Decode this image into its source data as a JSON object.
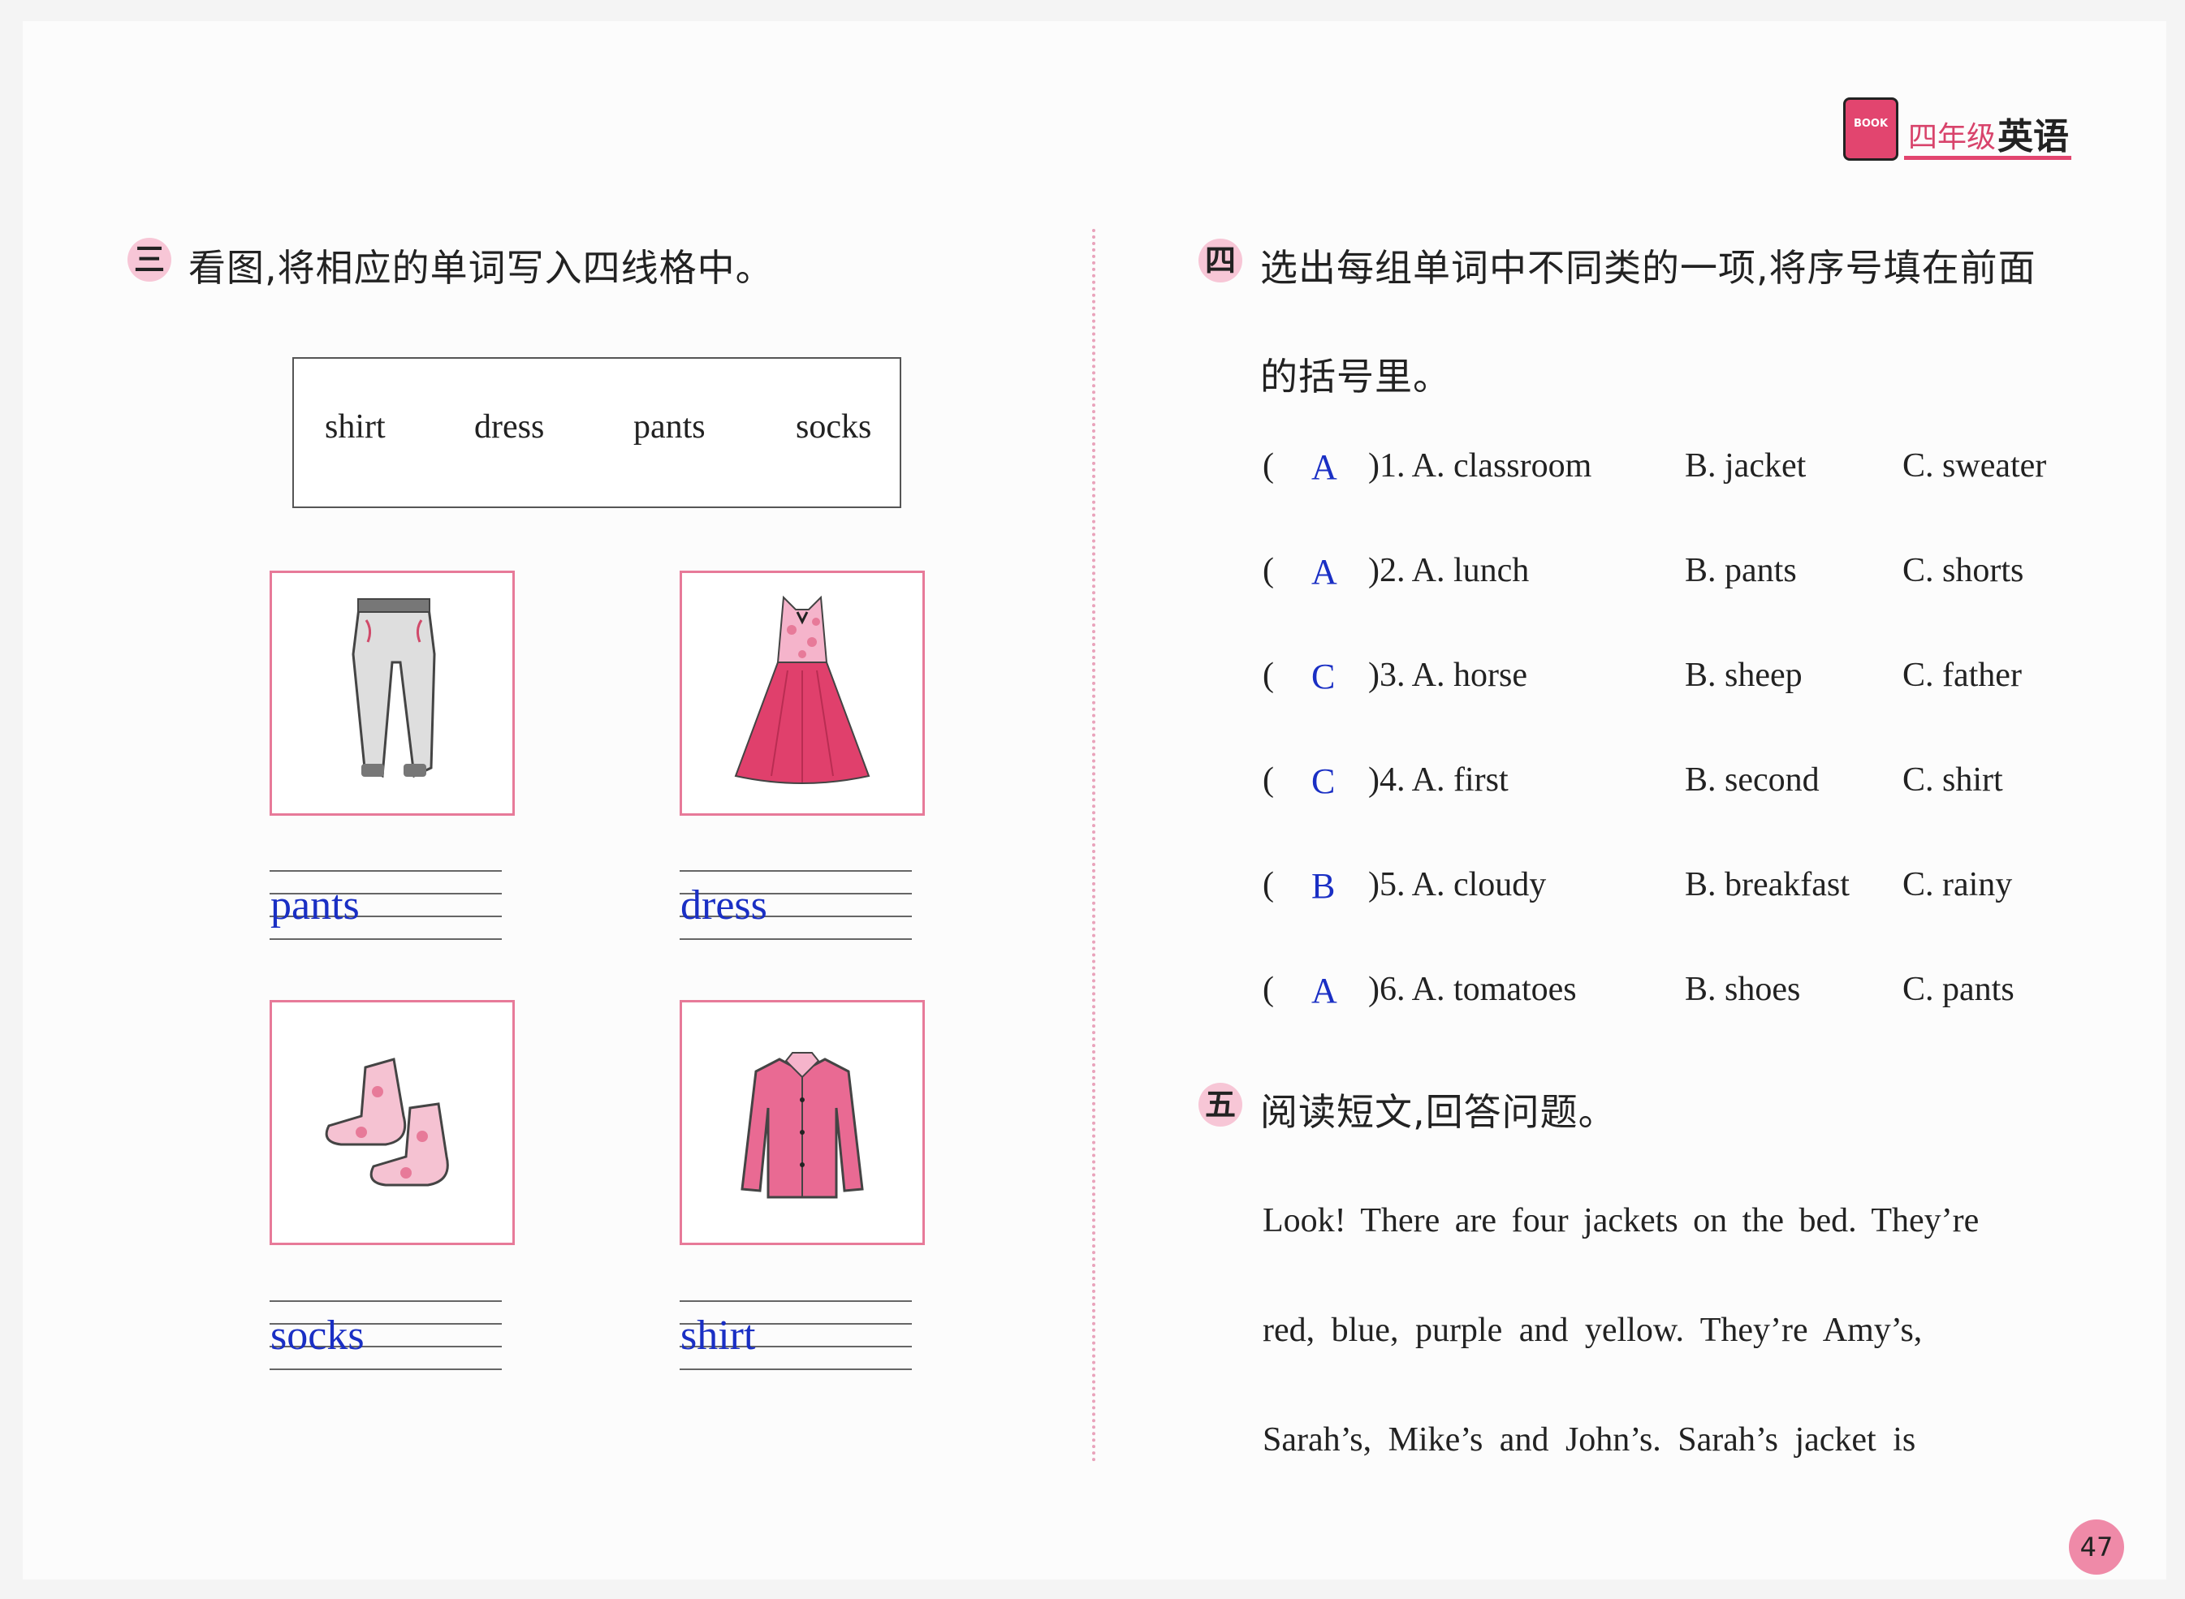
{
  "header": {
    "logo_text": "BOOK",
    "grade": "四年级",
    "subject": "英语"
  },
  "section3": {
    "number": "三",
    "instruction": "看图,将相应的单词写入四线格中。",
    "word_bank": [
      "shirt",
      "dress",
      "pants",
      "socks"
    ],
    "items": [
      {
        "picture": "pants-icon",
        "answer": "pants"
      },
      {
        "picture": "dress-icon",
        "answer": "dress"
      },
      {
        "picture": "socks-icon",
        "answer": "socks"
      },
      {
        "picture": "shirt-icon",
        "answer": "shirt"
      }
    ]
  },
  "section4": {
    "number": "四",
    "instruction_line1": "选出每组单词中不同类的一项,将序号填在前面",
    "instruction_line2": "的括号里。",
    "questions": [
      {
        "answer": "A",
        "num": ")1. A. classroom",
        "b": "B. jacket",
        "c": "C. sweater"
      },
      {
        "answer": "A",
        "num": ")2. A. lunch",
        "b": "B. pants",
        "c": "C. shorts"
      },
      {
        "answer": "C",
        "num": ")3. A. horse",
        "b": "B. sheep",
        "c": "C. father"
      },
      {
        "answer": "C",
        "num": ")4. A. first",
        "b": "B. second",
        "c": "C. shirt"
      },
      {
        "answer": "B",
        "num": ")5. A. cloudy",
        "b": "B. breakfast",
        "c": "C. rainy"
      },
      {
        "answer": "A",
        "num": ")6. A. tomatoes",
        "b": "B. shoes",
        "c": "C. pants"
      }
    ]
  },
  "section5": {
    "number": "五",
    "instruction": "阅读短文,回答问题。",
    "passage_lines": [
      "Look! There are four jackets on the bed. They’re",
      "red, blue, purple and yellow. They’re Amy’s,",
      "Sarah’s, Mike’s and John’s. Sarah’s jacket is"
    ]
  },
  "page_number": "47",
  "colors": {
    "accent": "#e2456f",
    "answer": "#1a2fc4",
    "frame": "#e77a99"
  }
}
